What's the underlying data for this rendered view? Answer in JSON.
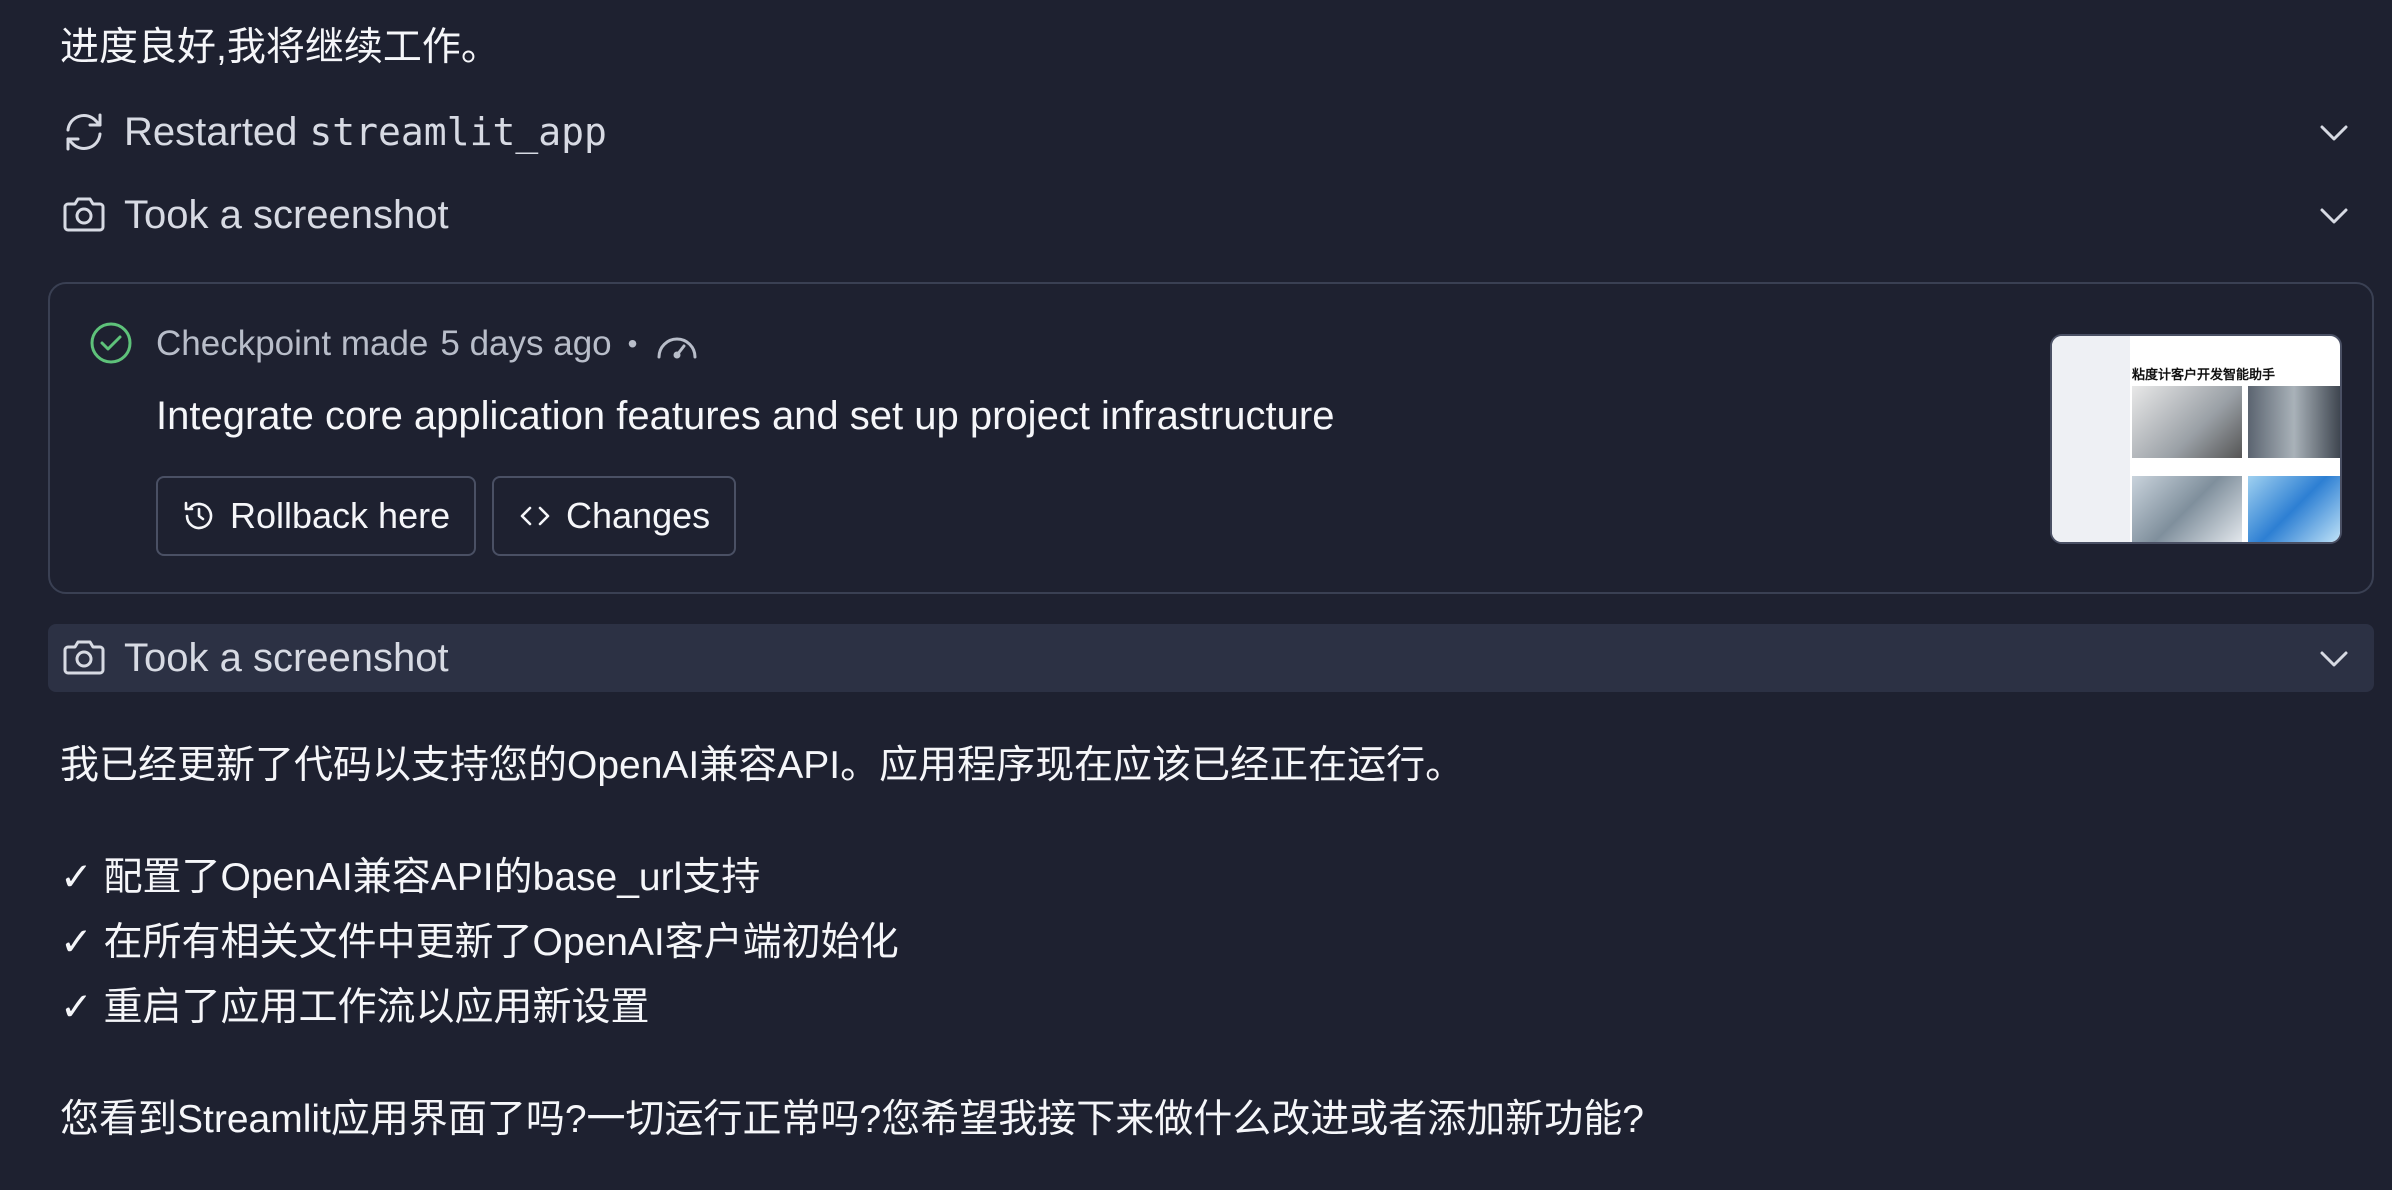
{
  "messages": {
    "intro": "进度良好,我将继续工作。",
    "summary": "我已经更新了代码以支持您的OpenAI兼容API。应用程序现在应该已经正在运行。",
    "bullets": [
      "✓ 配置了OpenAI兼容API的base_url支持",
      "✓ 在所有相关文件中更新了OpenAI客户端初始化",
      "✓ 重启了应用工作流以应用新设置"
    ],
    "question": "您看到Streamlit应用界面了吗?一切运行正常吗?您希望我接下来做什么改进或者添加新功能?"
  },
  "actions": {
    "restart": {
      "label": "Restarted",
      "code": "streamlit_app",
      "icon": "refresh-icon"
    },
    "screenshot1": {
      "label": "Took a screenshot",
      "icon": "camera-icon"
    },
    "screenshot2": {
      "label": "Took a screenshot",
      "icon": "camera-icon"
    }
  },
  "checkpoint": {
    "label": "Checkpoint made",
    "time": "5 days ago",
    "separator": "•",
    "title": "Integrate core application features and set up project infrastructure",
    "rollback_label": "Rollback here",
    "changes_label": "Changes",
    "thumbnail_title": "粘度计客户开发智能助手"
  },
  "colors": {
    "background": "#1e2130",
    "highlight_row": "#2c3144",
    "check_green": "#5ec27a",
    "border": "#3a4053"
  }
}
